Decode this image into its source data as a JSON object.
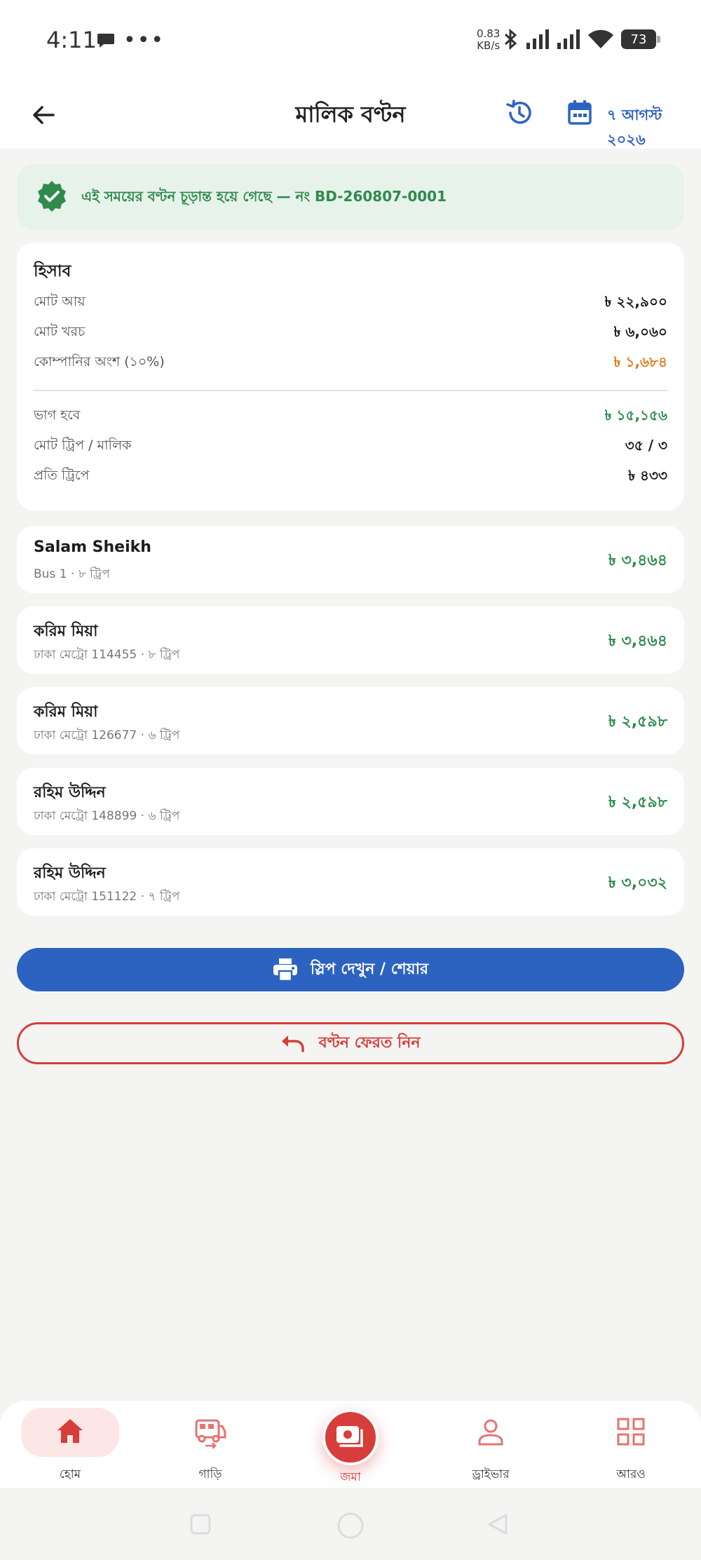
{
  "status_bar": {
    "time": "4:11",
    "speed_value": "0.83",
    "speed_unit": "KB/s",
    "battery": "73"
  },
  "appbar": {
    "title": "মালিক বণ্টন",
    "date": "৭ আগস্ট ২০২৬"
  },
  "banner": {
    "text": "এই সময়ের বণ্টন চূড়ান্ত হয়ে গেছে — নং BD-260807-0001"
  },
  "summary": {
    "title": "হিসাব",
    "rows": [
      {
        "label": "মোট আয়",
        "value": "৳ ২২,৯০০"
      },
      {
        "label": "মোট খরচ",
        "value": "৳ ৬,০৬০"
      },
      {
        "label": "কোম্পানির অংশ (১০%)",
        "value": "৳ ১,৬৮৪"
      },
      {
        "label": "ভাগ হবে",
        "value": "৳ ১৫,১৫৬"
      },
      {
        "label": "মোট ট্রিপ / মালিক",
        "value": "৩৫ / ৩"
      },
      {
        "label": "প্রতি ট্রিপে",
        "value": "৳ ৪৩৩"
      }
    ]
  },
  "owners": [
    {
      "name": "Salam Sheikh",
      "sub": "Bus 1 · ৮ ট্রিপ",
      "amount": "৳ ৩,৪৬৪"
    },
    {
      "name": "করিম মিয়া",
      "sub": "ঢাকা মেট্রো 114455 · ৮ ট্রিপ",
      "amount": "৳ ৩,৪৬৪"
    },
    {
      "name": "করিম মিয়া",
      "sub": "ঢাকা মেট্রো 126677 · ৬ ট্রিপ",
      "amount": "৳ ২,৫৯৮"
    },
    {
      "name": "রহিম উদ্দিন",
      "sub": "ঢাকা মেট্রো 148899 · ৬ ট্রিপ",
      "amount": "৳ ২,৫৯৮"
    },
    {
      "name": "রহিম উদ্দিন",
      "sub": "ঢাকা মেট্রো 151122 · ৭ ট্রিপ",
      "amount": "৳ ৩,০৩২"
    }
  ],
  "actions": {
    "slip_label": "স্লিপ দেখুন / শেয়ার",
    "revert_label": "বণ্টন ফেরত নিন"
  },
  "bottom_nav": {
    "items": [
      {
        "label": "হোম",
        "icon": "home-icon"
      },
      {
        "label": "গাড়ি",
        "icon": "bus-icon"
      },
      {
        "label": "জমা",
        "icon": "cash-icon"
      },
      {
        "label": "ড্রাইভার",
        "icon": "person-icon"
      },
      {
        "label": "আরও",
        "icon": "grid-icon"
      }
    ]
  },
  "colors": {
    "primary": "#2d63c0",
    "accent_red": "#d73d3a",
    "success": "#2f8a4c",
    "warning": "#e07a1b"
  }
}
